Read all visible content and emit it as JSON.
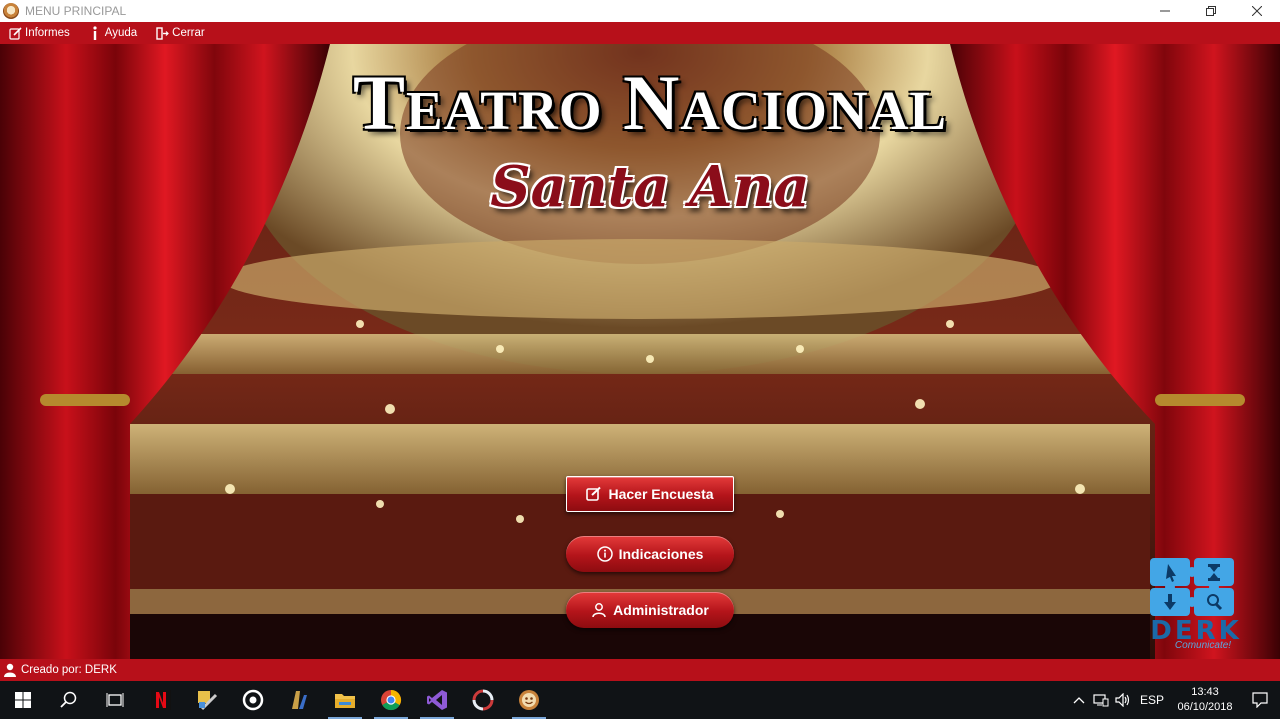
{
  "window": {
    "title": "MENU PRINCIPAL",
    "app_icon": "theater-mask-icon",
    "controls": [
      "minimize-icon",
      "maximize-icon",
      "close-icon"
    ]
  },
  "menu": {
    "items": [
      {
        "label": "Informes",
        "icon": "report-edit-icon"
      },
      {
        "label": "Ayuda",
        "icon": "info-icon"
      },
      {
        "label": "Cerrar",
        "icon": "exit-icon"
      }
    ]
  },
  "hero": {
    "title": "Teatro Nacional",
    "subtitle": "Santa Ana"
  },
  "buttons": {
    "encuesta": "Hacer Encuesta",
    "indicaciones": "Indicaciones",
    "administrador": "Administrador"
  },
  "logo": {
    "name": "DERK",
    "tagline": "Comunicate!"
  },
  "status": {
    "text": "Creado por: DERK"
  },
  "taskbar": {
    "apps": [
      "windows-start-icon",
      "search-icon",
      "task-view-icon",
      "netflix-icon",
      "tools-icon",
      "target-app-icon",
      "game-app-icon",
      "file-explorer-icon",
      "chrome-icon",
      "visual-studio-icon",
      "sync-app-icon",
      "theater-app-icon"
    ],
    "language": "ESP",
    "time": "13:43",
    "date": "06/10/2018"
  },
  "colors": {
    "accent_red": "#b7101a",
    "button_red": "#c8202a",
    "logo_blue": "#1b6aa8"
  }
}
